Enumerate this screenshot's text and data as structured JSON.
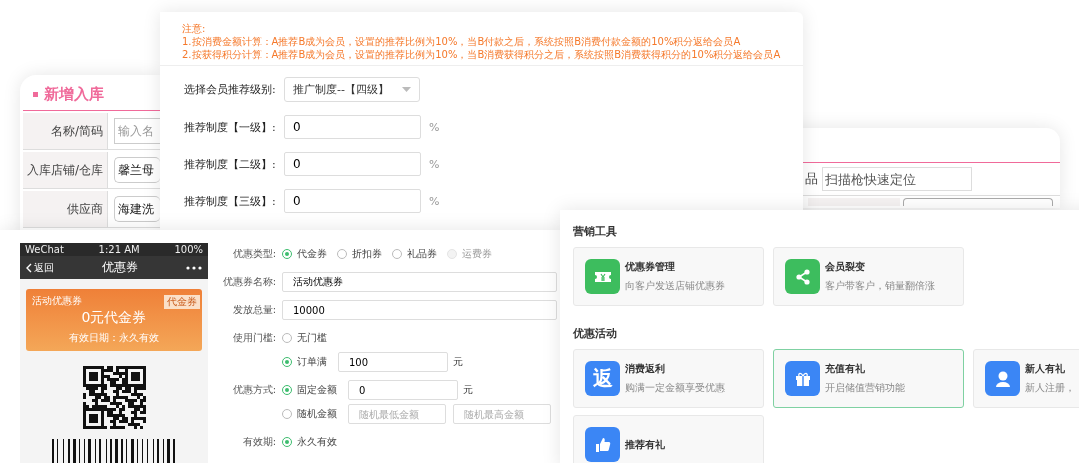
{
  "stock_in": {
    "title": "新增入库",
    "rows": [
      {
        "label": "名称/简码",
        "kind": "input",
        "placeholder": "输入名"
      },
      {
        "label": "入库店铺/仓库",
        "kind": "select",
        "value": "馨兰母"
      },
      {
        "label": "供应商",
        "kind": "select",
        "value": "海建洗"
      }
    ]
  },
  "referral": {
    "notice": [
      "注意:",
      "1.按消费金额计算：A推荐B成为会员，设置的推荐比例为10%，当B付款之后，系统按照B消费付款金额的10%积分返给会员A",
      "2.按获得积分计算：A推荐B成为会员，设置的推荐比例为10%，当B消费获得积分之后，系统按照B消费获得积分的10%积分返给会员A"
    ],
    "level_select": {
      "label": "选择会员推荐级别:",
      "value": "推广制度--【四级】"
    },
    "levels": [
      {
        "label": "推荐制度【一级】:",
        "value": "0",
        "unit": "%"
      },
      {
        "label": "推荐制度【二级】:",
        "value": "0",
        "unit": "%"
      },
      {
        "label": "推荐制度【三级】:",
        "value": "0",
        "unit": "%"
      }
    ]
  },
  "scan_panel": {
    "label": "品",
    "placeholder": "扫描枪快速定位"
  },
  "coupon_editor": {
    "phone": {
      "carrier": "WeChat",
      "time": "1:21 AM",
      "battery": "100%",
      "back": "返回",
      "title": "优惠券",
      "coupon_name": "活动优惠券",
      "coupon_tag": "代金券",
      "coupon_value": "0元代金券",
      "validity": "有效日期：永久有效"
    },
    "fields": [
      {
        "label": "优惠类型:",
        "kind": "radios",
        "options": [
          {
            "label": "代金券",
            "selected": true,
            "disabled": false
          },
          {
            "label": "折扣券",
            "selected": false,
            "disabled": false
          },
          {
            "label": "礼品券",
            "selected": false,
            "disabled": false
          },
          {
            "label": "运费券",
            "selected": false,
            "disabled": true
          }
        ]
      },
      {
        "label": "优惠券名称:",
        "kind": "input",
        "value": "活动优惠券"
      },
      {
        "label": "发放总量:",
        "kind": "input",
        "value": "10000"
      },
      {
        "label": "使用门槛:",
        "kind": "choices",
        "options": [
          {
            "label": "无门槛",
            "selected": false
          },
          {
            "label": "订单满",
            "selected": true,
            "inputs": [
              {
                "value": "100"
              }
            ],
            "unit": "元"
          }
        ]
      },
      {
        "label": "优惠方式:",
        "kind": "choices",
        "options": [
          {
            "label": "固定金额",
            "selected": true,
            "inputs": [
              {
                "value": "0"
              }
            ],
            "unit": "元"
          },
          {
            "label": "随机金额",
            "selected": false,
            "inputs": [
              {
                "placeholder": "随机最低金额"
              },
              {
                "placeholder": "随机最高金额"
              }
            ]
          }
        ]
      },
      {
        "label": "有效期:",
        "kind": "choices",
        "options": [
          {
            "label": "永久有效",
            "selected": true
          }
        ]
      }
    ]
  },
  "marketing": {
    "sections": [
      {
        "title": "营销工具",
        "cards": [
          {
            "kind": "ticket",
            "title": "优惠券管理",
            "desc": "向客户发送店铺优惠券",
            "selected": false
          },
          {
            "kind": "share",
            "title": "会员裂变",
            "desc": "客户带客户，销量翻倍涨",
            "selected": false
          }
        ]
      },
      {
        "title": "优惠活动",
        "cards": [
          {
            "kind": "glyph",
            "icon_text": "返",
            "title": "消费返利",
            "desc": "购满一定金额享受优惠",
            "selected": false
          },
          {
            "kind": "gift",
            "title": "充值有礼",
            "desc": "开启储值营销功能",
            "selected": true
          },
          {
            "kind": "user",
            "title": "新人有礼",
            "desc": "新人注册，",
            "selected": false
          },
          {
            "kind": "thumb",
            "title": "推荐有礼",
            "selected": false
          }
        ]
      }
    ]
  }
}
